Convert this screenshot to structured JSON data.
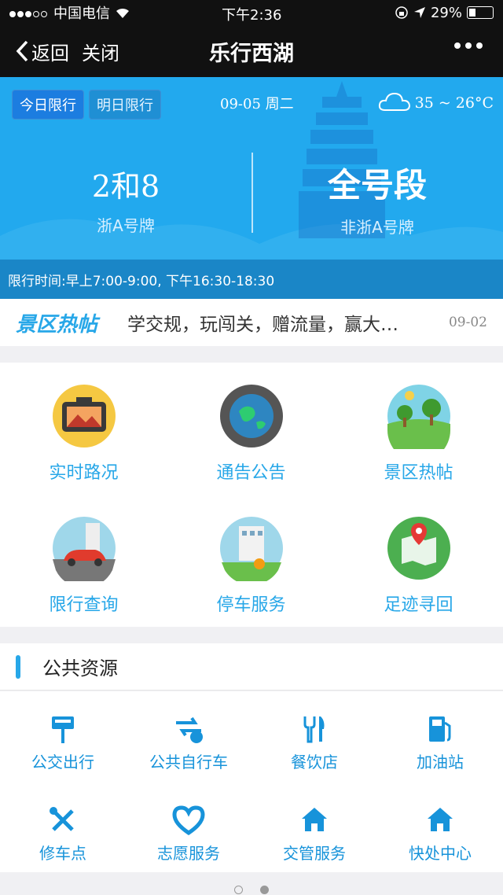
{
  "status": {
    "carrier": "中国电信",
    "time": "下午2:36",
    "battery": "29%"
  },
  "nav": {
    "back_label": "返回",
    "close_label": "关闭",
    "title": "乐行西湖"
  },
  "banner": {
    "tab_today": "今日限行",
    "tab_tomorrow": "明日限行",
    "date": "09-05 周二",
    "temperature": "35 ~ 26°C",
    "local_numbers": "2和8",
    "local_label": "浙A号牌",
    "nonlocal_numbers": "全号段",
    "nonlocal_label": "非浙A号牌",
    "restriction_time": "限行时间:早上7:00-9:00, 下午16:30-18:30"
  },
  "hot": {
    "brand": "景区热帖",
    "headline": "学交规，玩闯关，赠流量，赢大…",
    "date": "09-02"
  },
  "services": [
    {
      "label": "实时路况"
    },
    {
      "label": "通告公告"
    },
    {
      "label": "景区热帖"
    },
    {
      "label": "限行查询"
    },
    {
      "label": "停车服务"
    },
    {
      "label": "足迹寻回"
    }
  ],
  "public_resources": {
    "title": "公共资源",
    "items": [
      {
        "label": "公交出行"
      },
      {
        "label": "公共自行车"
      },
      {
        "label": "餐饮店"
      },
      {
        "label": "加油站"
      },
      {
        "label": "修车点"
      },
      {
        "label": "志愿服务"
      },
      {
        "label": "交管服务"
      },
      {
        "label": "快处中心"
      }
    ]
  },
  "colors": {
    "accent": "#27a7e8",
    "banner": "#22a9ee",
    "navbar": "#111111"
  }
}
